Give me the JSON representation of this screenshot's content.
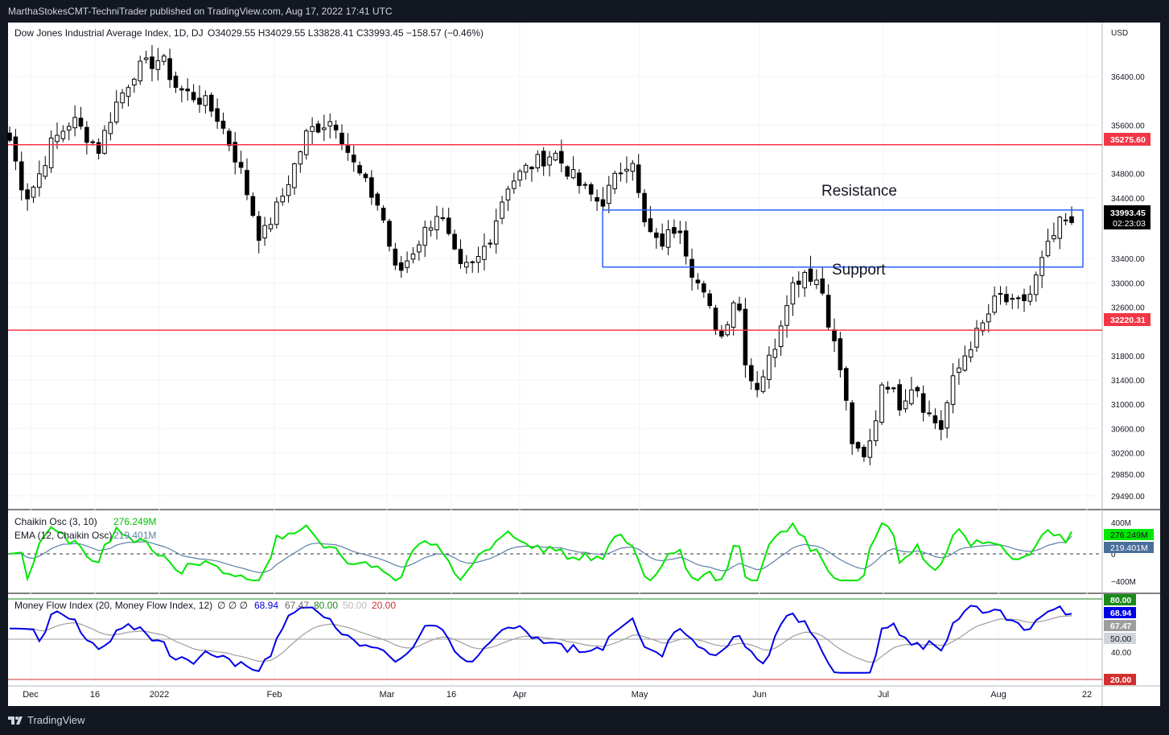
{
  "publisher_line": "MarthaStokesCMT-TechniTrader published on TradingView.com, Aug 17, 2022 17:41 UTC",
  "brand": "TradingView",
  "main_legend": {
    "title": "Dow Jones Industrial Average Index, 1D, DJ",
    "ohlc": "O34029.55  H34029.55  L33828.41  C33993.45  −158.57 (−0.46%)"
  },
  "currency": "USD",
  "price_ticks": [
    "36400.00",
    "35600.00",
    "34800.00",
    "34400.00",
    "33400.00",
    "33000.00",
    "32600.00",
    "31800.00",
    "31400.00",
    "31000.00",
    "30600.00",
    "30200.00",
    "29850.00",
    "29490.00"
  ],
  "price_badges": {
    "resistance_line": "35275.60",
    "last_price": "33993.45",
    "countdown": "02:23:03",
    "support_line": "32220.31"
  },
  "annotations": {
    "resistance": "Resistance",
    "support": "Support"
  },
  "chaikin": {
    "legend1_name": "Chaikin Osc (3, 10)",
    "legend1_value": "276.249M",
    "legend2_name": "EMA (12, Chaikin Osc)",
    "legend2_value": "219.401M",
    "ticks": [
      "400M",
      "0",
      "−400M"
    ],
    "badge_osc": "276.249M",
    "badge_ema": "219.401M"
  },
  "mfi": {
    "legend_name": "Money Flow Index (20, Money Flow Index, 12)",
    "legend_dots": "∅ ∅ ∅",
    "legend_v1": "68.94",
    "legend_v2": "67.47",
    "legend_v3": "80.00",
    "legend_v4": "50.00",
    "legend_v5": "20.00",
    "ticks": [
      "40.00"
    ],
    "badge_80": "80.00",
    "badge_mfi": "68.94",
    "badge_ma": "67.47",
    "badge_50": "50.00",
    "badge_20": "20.00"
  },
  "time_ticks": [
    "Dec",
    "16",
    "2022",
    "Feb",
    "Mar",
    "16",
    "Apr",
    "May",
    "Jun",
    "Jul",
    "Aug",
    "22"
  ],
  "colors": {
    "up": "#ffffff",
    "down": "#000000",
    "wick": "#000000",
    "level_line": "#f23645",
    "box": "#2962ff",
    "osc": "#00e600",
    "osc_ema": "#5b7fa6",
    "mfi": "#0000e6",
    "mfi_ma": "#9e9e9e",
    "mfi_80": "#1b8a1b",
    "mfi_20": "#d32f2f"
  },
  "chart_data": {
    "type": "candlestick",
    "symbol": "Dow Jones Industrial Average Index",
    "interval": "1D",
    "price_levels": {
      "resistance": 35275.6,
      "support": 32220.31
    },
    "zone": {
      "top": 34200,
      "bottom": 33260
    },
    "last": {
      "open": 34029.55,
      "high": 34029.55,
      "low": 33828.41,
      "close": 33993.45,
      "change": -158.57,
      "change_pct": -0.46
    },
    "price_axis": {
      "ylim": [
        29300,
        36900
      ]
    },
    "key_closes": [
      {
        "date": "Jan 4",
        "close": 36799
      },
      {
        "date": "Mar 8",
        "close": 32632
      },
      {
        "date": "Apr 20",
        "close": 35160
      },
      {
        "date": "Jun 16",
        "close": 29927
      },
      {
        "date": "Aug 16",
        "close": 34152
      },
      {
        "date": "Aug 17",
        "close": 33993.45
      }
    ],
    "chaikin_osc": {
      "osc": 276.249,
      "ema": 219.401,
      "unit": "M",
      "ylim": [
        -400,
        400
      ]
    },
    "money_flow_index": {
      "mfi": 68.94,
      "ma": 67.47,
      "bands": [
        80,
        50,
        20
      ]
    }
  }
}
